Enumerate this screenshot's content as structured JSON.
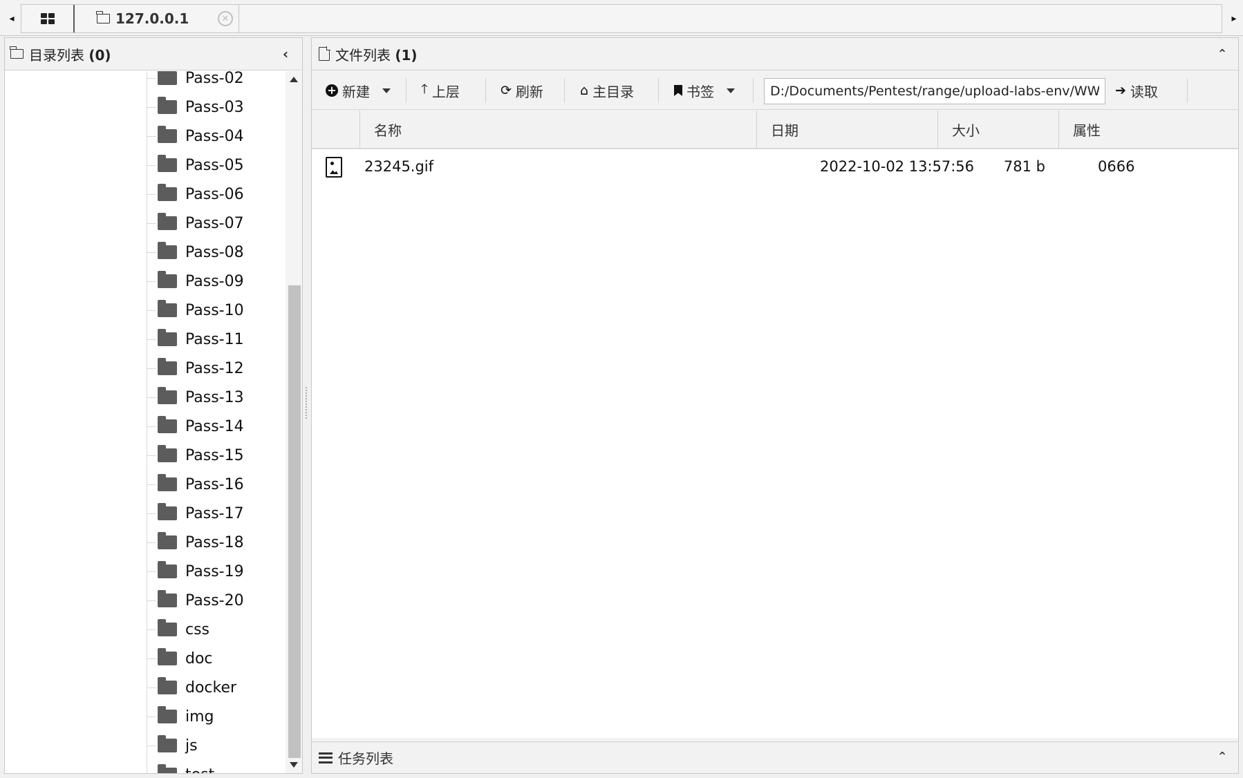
{
  "tabs": {
    "home_icon": "grid-icon",
    "active_tab": {
      "label": "127.0.0.1",
      "icon": "folder-outline-icon",
      "close_icon": "close-circle-icon"
    }
  },
  "dir_panel": {
    "title": "目录列表",
    "count": "(0)",
    "items": [
      "Pass-02",
      "Pass-03",
      "Pass-04",
      "Pass-05",
      "Pass-06",
      "Pass-07",
      "Pass-08",
      "Pass-09",
      "Pass-10",
      "Pass-11",
      "Pass-12",
      "Pass-13",
      "Pass-14",
      "Pass-15",
      "Pass-16",
      "Pass-17",
      "Pass-18",
      "Pass-19",
      "Pass-20",
      "css",
      "doc",
      "docker",
      "img",
      "js",
      "test"
    ]
  },
  "file_panel": {
    "title": "文件列表",
    "count": "(1)",
    "toolbar": {
      "new_label": "新建",
      "up_label": "上层",
      "refresh_label": "刷新",
      "home_label": "主目录",
      "bookmark_label": "书签",
      "path_value": "D:/Documents/Pentest/range/upload-labs-env/WWW/up",
      "read_label": "读取"
    },
    "columns": {
      "name": "名称",
      "date": "日期",
      "size": "大小",
      "attr": "属性"
    },
    "files": [
      {
        "name": "23245.gif",
        "date": "2022-10-02 13:57:56",
        "size": "781 b",
        "attr": "0666",
        "icon": "image-file-icon"
      }
    ]
  },
  "task_panel": {
    "title": "任务列表"
  }
}
